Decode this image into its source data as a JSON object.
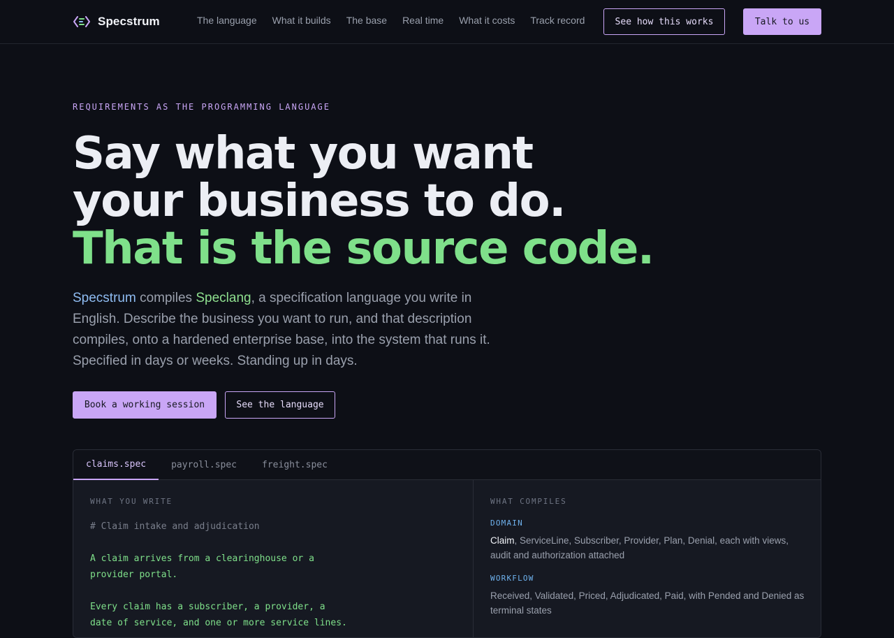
{
  "brand": {
    "name": "Specstrum",
    "logo_icon": "bracket-lines-icon"
  },
  "nav": {
    "links": [
      "The language",
      "What it builds",
      "The base",
      "Real time",
      "What it costs",
      "Track record"
    ],
    "see_how": "See how this works",
    "talk": "Talk to us"
  },
  "hero": {
    "eyebrow": "REQUIREMENTS AS THE PROGRAMMING LANGUAGE",
    "headline_1": "Say what you want",
    "headline_2": "your business to do.",
    "headline_3": "That is the source code.",
    "lede_product": "Specstrum",
    "lede_verb": " compiles ",
    "lede_lang": "Speclang",
    "lede_rest": ", a specification language you write in English. Describe the business you want to run, and that description compiles, onto a hardened enterprise base, into the system that runs it. Specified in days or weeks. Standing up in days.",
    "cta_primary": "Book a working session",
    "cta_secondary": "See the language"
  },
  "panel": {
    "tabs": [
      "claims.spec",
      "payroll.spec",
      "freight.spec"
    ],
    "active_tab": 0,
    "left_label": "WHAT YOU WRITE",
    "right_label": "WHAT COMPILES",
    "code": {
      "comment": "# Claim intake and adjudication",
      "lines_a": [
        "A claim arrives from a clearinghouse or a",
        "provider portal."
      ],
      "lines_b": [
        "Every claim has a subscriber, a provider, a",
        "date of service, and one or more service lines."
      ]
    },
    "sections": [
      {
        "title": "DOMAIN",
        "strong": "Claim",
        "body": ", ServiceLine, Subscriber, Provider, Plan, Denial, each with views, audit and authorization attached"
      },
      {
        "title": "WORKFLOW",
        "strong": "",
        "body": "Received, Validated, Priced, Adjudicated, Paid, with Pended and Denied as terminal states"
      }
    ]
  },
  "colors": {
    "background": "#0d0f16",
    "accent_purple": "#c9a6f6",
    "accent_green": "#7fe08a",
    "accent_blue": "#8fbcf2"
  }
}
